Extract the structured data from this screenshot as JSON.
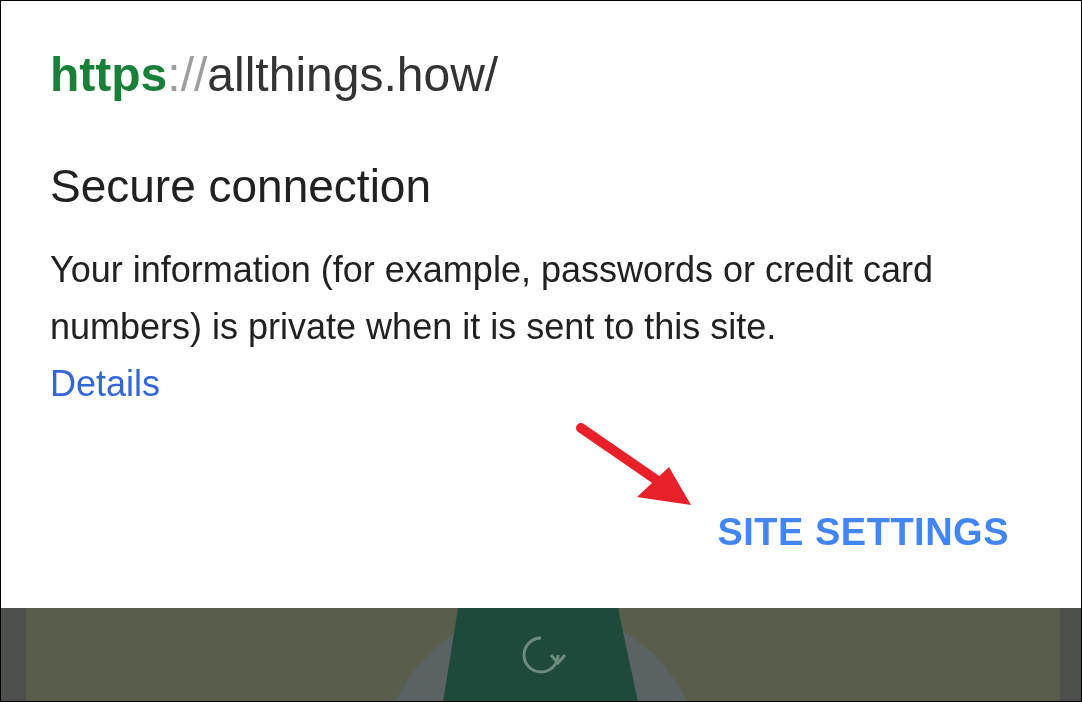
{
  "url": {
    "scheme": "https",
    "separator": "://",
    "host": "allthings.how/"
  },
  "title": "Secure connection",
  "body": "Your information (for example, passwords or credit card numbers) is private when it is sent to this site.",
  "details_link": "Details",
  "button": "SITE SETTINGS"
}
